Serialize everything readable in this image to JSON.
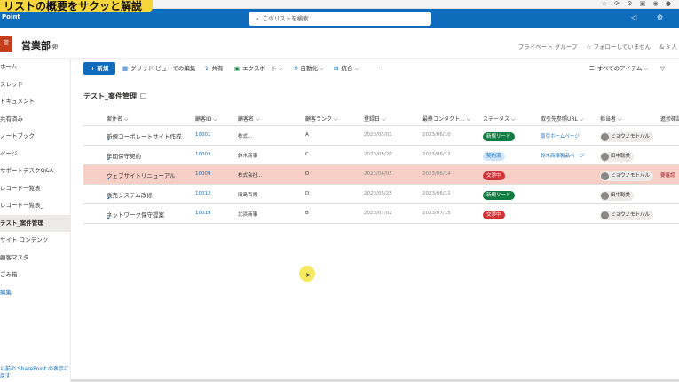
{
  "caption": "リストの概要をサクッと解説",
  "brand": "Point",
  "search": {
    "placeholder": "このリストを検索"
  },
  "site": {
    "logo": "営",
    "title": "営業部",
    "title_suffix": "卵",
    "meta": [
      "プライベート グループ",
      "☆ フォローしていません",
      "& 3 人"
    ]
  },
  "nav": [
    "ホーム",
    "スレッド",
    "ドキュメント",
    "共有済み",
    "ノートブック",
    "ページ",
    "サポートデスクQ&A",
    "レコード一覧表",
    "レコード一覧表_",
    "テスト_案件管理",
    "サイト コンテンツ",
    "顧客マスタ",
    "ごみ箱",
    "編集"
  ],
  "nav_footer": [
    "以前の SharePoint の表示に",
    "戻す"
  ],
  "commands": {
    "new": "+ 新規",
    "grid": "グリッド ビューでの編集",
    "share": "共有",
    "export": "エクスポート ⌵",
    "automate": "自動化 ⌵",
    "integrate": "統合 ⌵",
    "more": "···",
    "view": "すべてのアイテム ⌵",
    "filter": "▽"
  },
  "list_title": "テスト_案件管理",
  "columns": [
    "案件名 ⌵",
    "顧客ID ⌵",
    "顧客名 ⌵",
    "顧客ランク ⌵",
    "登録日 ⌵",
    "最終コンタクト... ⌵",
    "ステータス ⌵",
    "取引先参照URL ⌵",
    "担当者 ⌵",
    "進捗確認"
  ],
  "rows": [
    {
      "title": "新規コーポレートサイト作成",
      "id": "10001",
      "customer": "株式...",
      "rank": "A",
      "registered": "2023/05/01",
      "last": "2023/06/10",
      "status": "新規リード",
      "status_color": "green",
      "url": "取引ホームページ",
      "owner": "ヒョウノモトハル",
      "progress": ""
    },
    {
      "title": "年間保守契約",
      "id": "10003",
      "customer": "鈴木商事",
      "rank": "C",
      "registered": "2023/05/20",
      "last": "2023/06/12",
      "status": "契約済",
      "status_color": "blue",
      "url": "鈴木商事製品ページ",
      "owner": "田中聡美",
      "progress": ""
    },
    {
      "title": "ウェブサイトリニューアル",
      "id": "10009",
      "customer": "株式会社...",
      "rank": "D",
      "registered": "2023/06/05",
      "last": "2023/06/14",
      "status": "交渉中",
      "status_color": "red",
      "url": "",
      "owner": "ヒョウノモトハル",
      "progress": "要確認"
    },
    {
      "title": "販売システム改修",
      "id": "10012",
      "customer": "田島百貨",
      "rank": "D",
      "registered": "2023/05/25",
      "last": "2023/06/11",
      "status": "新規リード",
      "status_color": "green",
      "url": "",
      "owner": "田中聡美",
      "progress": ""
    },
    {
      "title": "ネットワーク保守提案",
      "id": "10019",
      "customer": "北浜商事",
      "rank": "B",
      "registered": "2023/07/02",
      "last": "2023/07/15",
      "status": "交渉中",
      "status_color": "red",
      "url": "",
      "owner": "ヒョウノモトハル",
      "progress": ""
    }
  ]
}
